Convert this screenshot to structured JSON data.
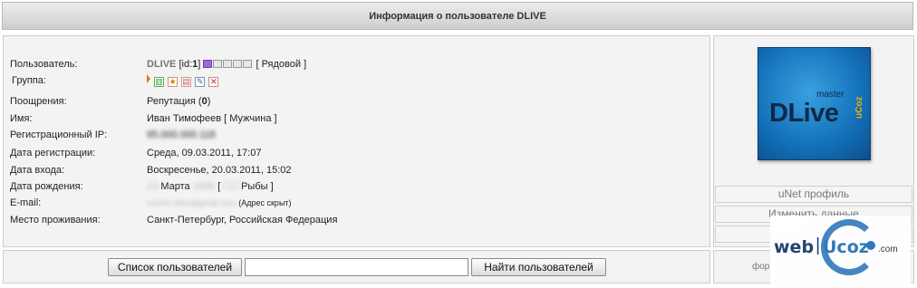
{
  "header": {
    "title": "Информация о пользователе DLIVE"
  },
  "profile": {
    "user": {
      "label": "Пользователь:",
      "nick": "DLIVE",
      "id_prefix": "[id:",
      "id": "1",
      "id_suffix": "]",
      "rank": "[ Рядовой ]",
      "rank_level": 1,
      "rank_total": 5
    },
    "group": {
      "label": "Группа:",
      "icons": [
        "green-chart-icon",
        "star-icon",
        "page-icon",
        "pencil-icon",
        "close-icon"
      ]
    },
    "rewards": {
      "label": "Поощрения:",
      "reputation_label": "Репутация (",
      "reputation_value": "0",
      "reputation_suffix": ")"
    },
    "name": {
      "label": "Имя:",
      "value": "Иван Тимофеев [ Мужчина ]"
    },
    "ip": {
      "label": "Регистрационный IP:",
      "value": "95.000.000.118"
    },
    "registered": {
      "label": "Дата регистрации:",
      "value": "Среда, 09.03.2011, 17:07"
    },
    "last_login": {
      "label": "Дата входа:",
      "value": "Воскресенье, 20.03.2011, 15:02"
    },
    "birthday": {
      "label": "Дата рождения:",
      "day": "13",
      "month": "Марта",
      "year": "1990",
      "sign_open": "[",
      "sign": "Рыбы",
      "sign_close": "]"
    },
    "email": {
      "label": "E-mail:",
      "value": "xxxlive.dlive@gmail.com",
      "note": "(Адрес скрыт)"
    },
    "location": {
      "label": "Место проживания:",
      "value": "Санкт-Петербург, Российская Федерация"
    }
  },
  "avatar": {
    "text": "DLive",
    "master": "master",
    "ucoz": "uCoz"
  },
  "side": {
    "unet_profile": "uNet профиль",
    "edit_data": "Изменить данные",
    "forum_prefix": "фор"
  },
  "bottom": {
    "user_list_button": "Список пользователей",
    "search_placeholder": "",
    "search_value": "",
    "find_button": "Найти пользователей"
  },
  "watermark": {
    "web": "web",
    "ucoz": "Ucoz",
    "com": ".com",
    "sep": "|"
  },
  "colors": {
    "rank_on": "#9c6ad6",
    "avatar_bg": "#1370b8",
    "watermark_blue": "#2a74b8"
  }
}
